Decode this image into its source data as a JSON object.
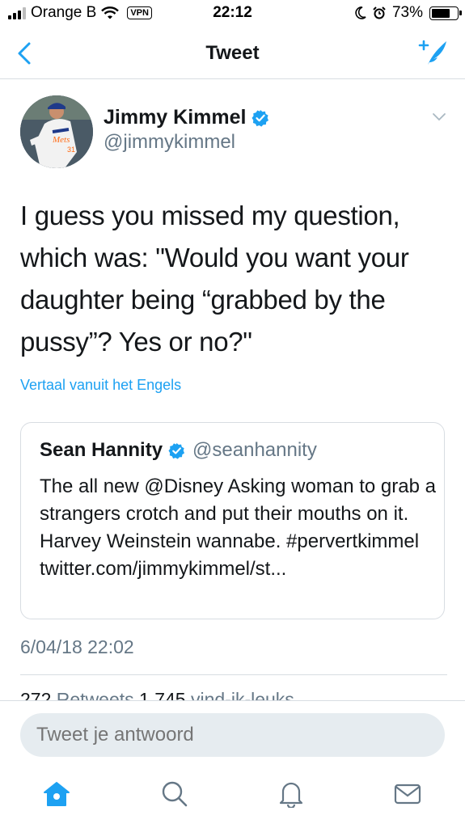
{
  "status_bar": {
    "carrier": "Orange B",
    "vpn": "VPN",
    "time": "22:12",
    "battery_percent": "73%",
    "battery_level": 0.73,
    "icons": [
      "signal-icon",
      "wifi-icon",
      "moon-icon",
      "alarm-icon",
      "battery-icon"
    ]
  },
  "nav": {
    "title": "Tweet",
    "back_icon": "chevron-left-icon",
    "compose_icon": "compose-tweet-icon"
  },
  "tweet": {
    "author_name": "Jimmy Kimmel",
    "author_handle": "@jimmykimmel",
    "verified": true,
    "text": "I guess you missed my question, which was: \"Would you want your daughter being “grabbed by the pussy”?  Yes or no?\"",
    "translate_label": "Vertaal vanuit het Engels",
    "timestamp": "6/04/18 22:02",
    "retweets_count": "272",
    "retweets_label": "Retweets",
    "likes_count": "1.745",
    "likes_label": "vind-ik-leuks"
  },
  "quote": {
    "name": "Sean Hannity",
    "handle": "@seanhannity",
    "verified": true,
    "text": "The all new @Disney Asking woman to grab a strangers crotch and put their mouths on it. Harvey Weinstein wannabe. #pervertkimmel twitter.com/jimmykimmel/st..."
  },
  "reply": {
    "placeholder": "Tweet je antwoord"
  },
  "tabs": [
    "home-icon",
    "search-icon",
    "notifications-icon",
    "messages-icon"
  ],
  "colors": {
    "accent": "#1da1f2",
    "muted": "#657786",
    "border": "#d8dde2",
    "input_bg": "#e6ecf0"
  }
}
